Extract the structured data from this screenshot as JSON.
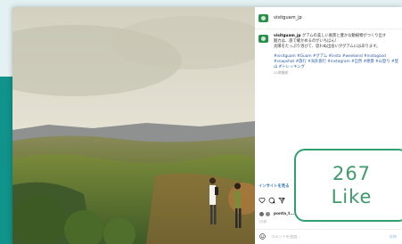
{
  "post": {
    "username": "visitguam_jp",
    "caption_lines": [
      "グアムの美しい風景と豊かな動植物がつくり出す",
      "魅力は、旅で確かめるのがいちばん！",
      "太陽をたっぷり浴びて、思わぬ出会いがグアムにはあります。"
    ],
    "hashtags": "#visitguam #Guam #グアム #insta #weekend #instagood #snapshot #旅行 #海外旅行 #instagram #自然 #絶景 #山登り #登山 #トレッキング",
    "time_ago": "22時間前",
    "insights_link": "インサイトを見る",
    "liked_by": "ponta_t...",
    "days_ago": "1日前",
    "comment_placeholder": "コメントを追加...",
    "post_label": "投稿"
  },
  "overlay": {
    "like_count": "267",
    "like_label": "Like"
  },
  "icons": [
    "heart-icon",
    "comment-icon",
    "share-icon",
    "smile-icon"
  ],
  "colors": {
    "teal": "#10938a",
    "bubble_border": "#2fa16c",
    "bubble_text": "#3f9a6a",
    "hashtag": "#2a5ba8"
  }
}
